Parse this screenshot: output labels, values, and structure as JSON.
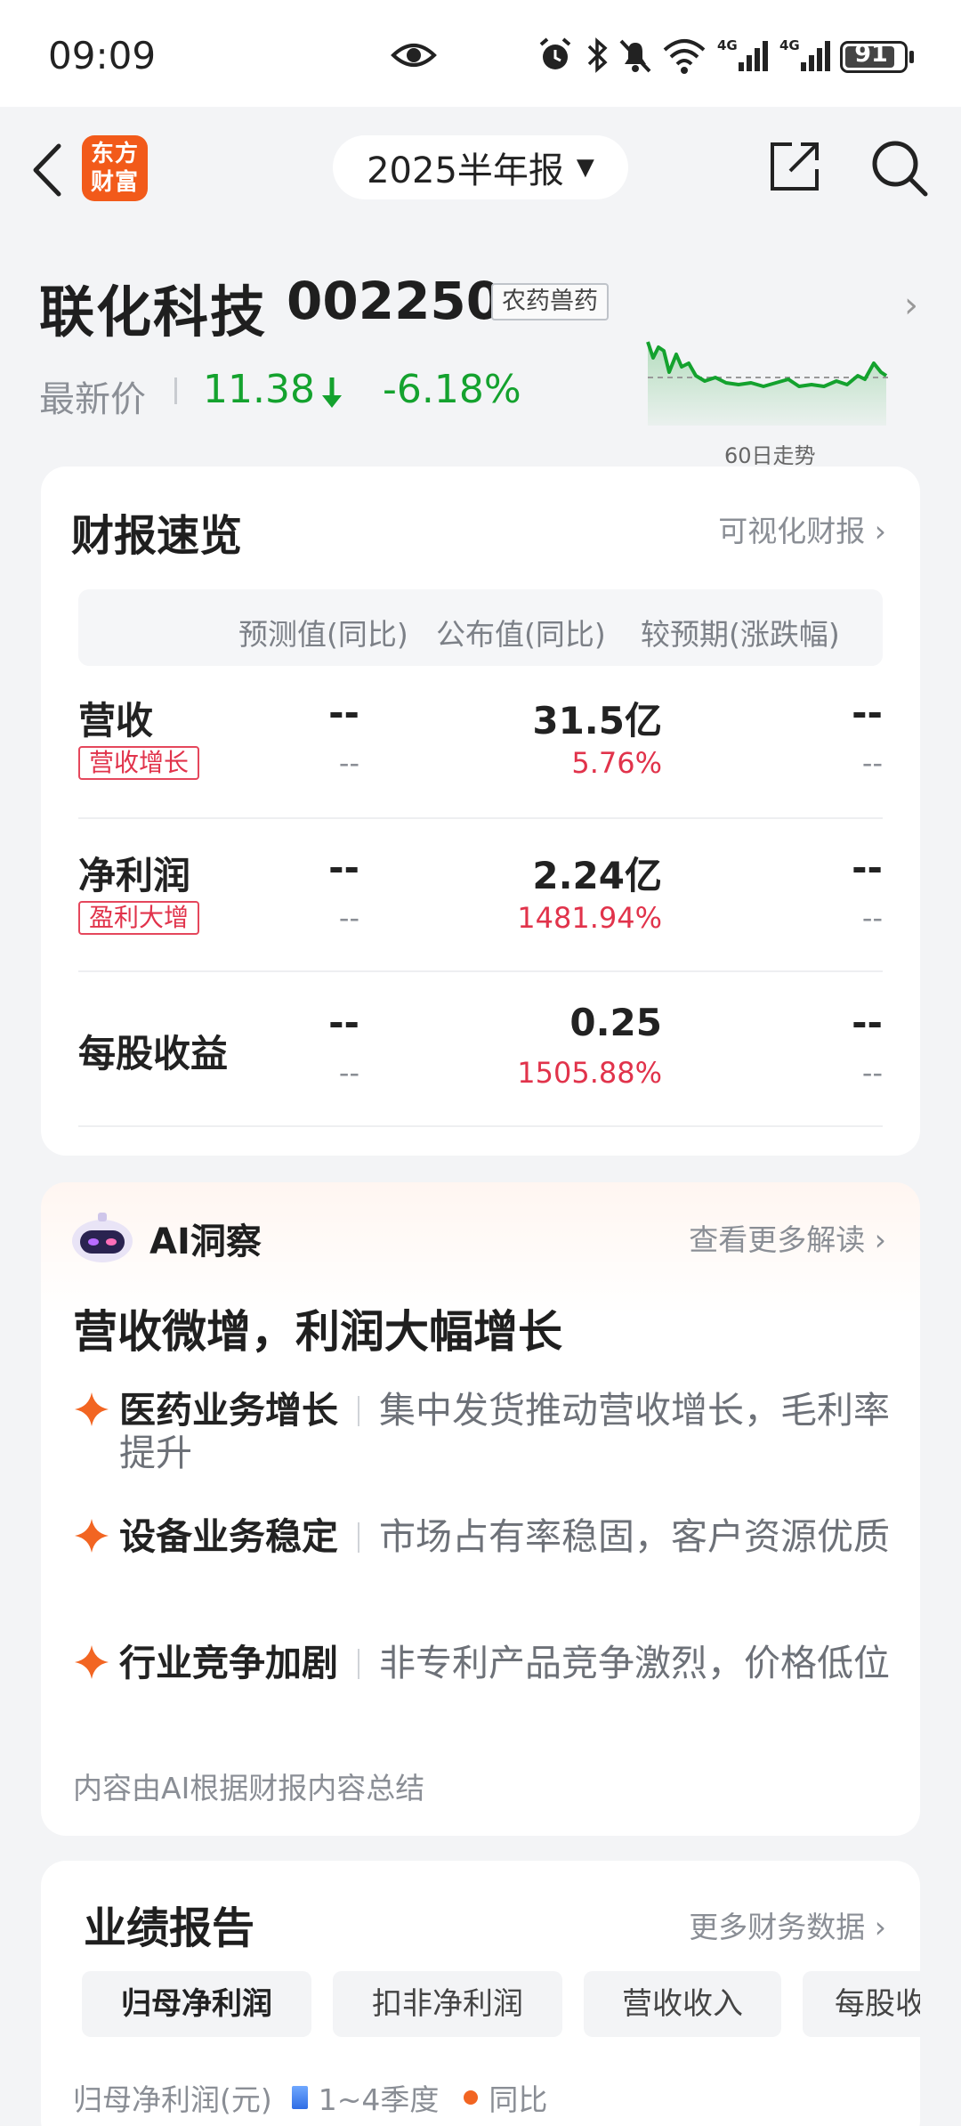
{
  "status_bar": {
    "time": "09:09",
    "battery": "91"
  },
  "nav": {
    "logo_text": "东方财富",
    "report_period": "2025半年报"
  },
  "stock": {
    "name": "联化科技",
    "code": "002250",
    "industry_tag": "农药兽药",
    "latest_price_label": "最新价",
    "price": "11.38",
    "change_pct": "-6.18%",
    "trend_label": "60日走势",
    "trend_color": "#14a22e"
  },
  "summary": {
    "title": "财报速览",
    "link": "可视化财报",
    "headers": [
      "预测值(同比)",
      "公布值(同比)",
      "较预期(涨跌幅)"
    ],
    "rows": [
      {
        "name": "营收",
        "tag": "营收增长",
        "forecast": "--",
        "forecast_yoy": "--",
        "actual": "31.5亿",
        "actual_yoy": "5.76%",
        "vs": "--",
        "vs_sub": "--"
      },
      {
        "name": "净利润",
        "tag": "盈利大增",
        "forecast": "--",
        "forecast_yoy": "--",
        "actual": "2.24亿",
        "actual_yoy": "1481.94%",
        "vs": "--",
        "vs_sub": "--"
      },
      {
        "name": "每股收益",
        "tag": "",
        "forecast": "--",
        "forecast_yoy": "--",
        "actual": "0.25",
        "actual_yoy": "1505.88%",
        "vs": "--",
        "vs_sub": "--"
      }
    ]
  },
  "ai": {
    "title": "AI洞察",
    "link": "查看更多解读",
    "headline": "营收微增，利润大幅增长",
    "items": [
      {
        "key": "医药业务增长",
        "desc": "集中发货推动营收增长，毛利率提升"
      },
      {
        "key": "设备业务稳定",
        "desc": "市场占有率稳固，客户资源优质"
      },
      {
        "key": "行业竞争加剧",
        "desc": "非专利产品竞争激烈，价格低位"
      }
    ],
    "footnote": "内容由AI根据财报内容总结"
  },
  "performance": {
    "title": "业绩报告",
    "link": "更多财务数据",
    "tabs": [
      "归母净利润",
      "扣非净利润",
      "营收收入",
      "每股收益"
    ],
    "legend_label": "归母净利润(元)",
    "legend_series_1": "1~4季度",
    "legend_series_2": "同比"
  }
}
